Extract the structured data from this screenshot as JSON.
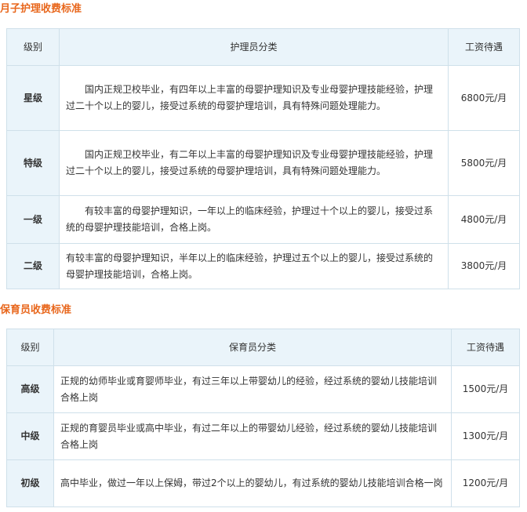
{
  "section1": {
    "title": "月子护理收费标准",
    "headers": {
      "level": "级别",
      "category": "护理员分类",
      "salary": "工资待遇"
    },
    "rows": [
      {
        "level": "星级",
        "desc": "国内正规卫校毕业，有四年以上丰富的母婴护理知识及专业母婴护理技能经验，护理过二十个以上的婴儿，接受过系统的母婴护理培训，具有特殊问题处理能力。",
        "salary": "6800元/月"
      },
      {
        "level": "特级",
        "desc": "国内正规卫校毕业，有二年以上丰富的母婴护理知识及专业母婴护理技能经验，护理过二十个以上的婴儿，接受过系统的母婴护理培训，具有特殊问题处理能力。",
        "salary": "5800元/月"
      },
      {
        "level": "一级",
        "desc": "有较丰富的母婴护理知识，一年以上的临床经验，护理过十个以上的婴儿，接受过系统的母婴护理技能培训，合格上岗。",
        "salary": "4800元/月"
      },
      {
        "level": "二级",
        "desc": "有较丰富的母婴护理知识，半年以上的临床经验，护理过五个以上的婴儿，接受过系统的母婴护理技能培训，合格上岗。",
        "salary": "3800元/月"
      }
    ]
  },
  "section2": {
    "title": "保育员收费标准",
    "headers": {
      "level": "级别",
      "category": "保育员分类",
      "salary": "工资待遇"
    },
    "rows": [
      {
        "level": "高级",
        "desc": "正规的幼师毕业或育婴师毕业，有过三年以上带婴幼儿的经验，经过系统的婴幼儿技能培训合格上岗",
        "salary": "1500元/月"
      },
      {
        "level": "中级",
        "desc": "正规的育婴员毕业或高中毕业，有过二年以上的带婴幼儿经验，经过系统的婴幼儿技能培训合格上岗",
        "salary": "1300元/月"
      },
      {
        "level": "初级",
        "desc": "高中毕业，做过一年以上保姆，带过2个以上的婴幼儿，有过系统的婴幼儿技能培训合格一岗",
        "salary": "1200元/月"
      }
    ]
  }
}
